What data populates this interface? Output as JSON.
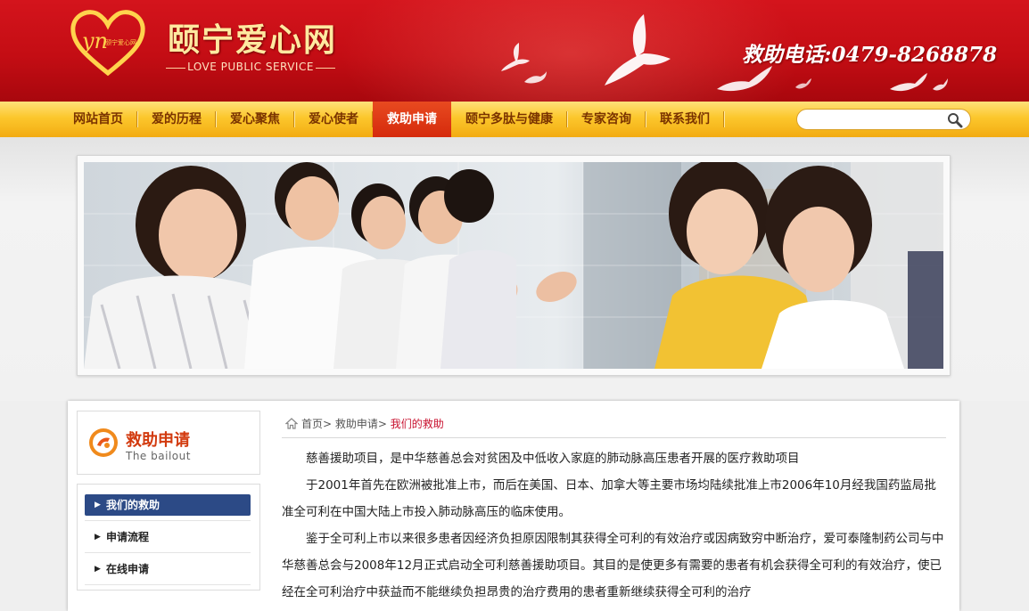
{
  "header": {
    "logo_text": "颐宁爱心网",
    "site_name": "颐宁爱心网",
    "site_subtitle": "LOVE PUBLIC SERVICE",
    "hotline": "救助电话:0479-8268878",
    "logo_icon": "heart-logo-icon",
    "accent_color": "#c40d14"
  },
  "nav": {
    "items": [
      {
        "label": "网站首页"
      },
      {
        "label": "爱的历程"
      },
      {
        "label": "爱心聚焦"
      },
      {
        "label": "爱心使者"
      },
      {
        "label": "救助申请"
      },
      {
        "label": "颐宁多肽与健康"
      },
      {
        "label": "专家咨询"
      },
      {
        "label": "联系我们"
      }
    ],
    "active_index": 4,
    "search": {
      "placeholder": "",
      "value": ""
    }
  },
  "sidebar": {
    "title": "救助申请",
    "subtitle": "The bailout",
    "items": [
      {
        "label": "我们的救助",
        "active": true
      },
      {
        "label": "申请流程",
        "active": false
      },
      {
        "label": "在线申请",
        "active": false
      }
    ]
  },
  "breadcrumb": {
    "home": "首页",
    "parent": "救助申请",
    "current": "我们的救助"
  },
  "article": {
    "paragraphs": [
      "慈善援助项目，是中华慈善总会对贫困及中低收入家庭的肺动脉高压患者开展的医疗救助项目",
      "于2001年首先在欧洲被批准上市，而后在美国、日本、加拿大等主要市场均陆续批准上市2006年10月经我国药监局批准全可利在中国大陆上市投入肺动脉高压的临床使用。",
      "鉴于全可利上市以来很多患者因经济负担原因限制其获得全可利的有效治疗或因病致穷中断治疗，爱可泰隆制药公司与中华慈善总会与2008年12月正式启动全可利慈善援助项目。其目的是使更多有需要的患者有机会获得全可利的有效治疗，使已经在全可利治疗中获益而不能继续负担昂贵的治疗费用的患者重新继续获得全可利的治疗"
    ]
  }
}
